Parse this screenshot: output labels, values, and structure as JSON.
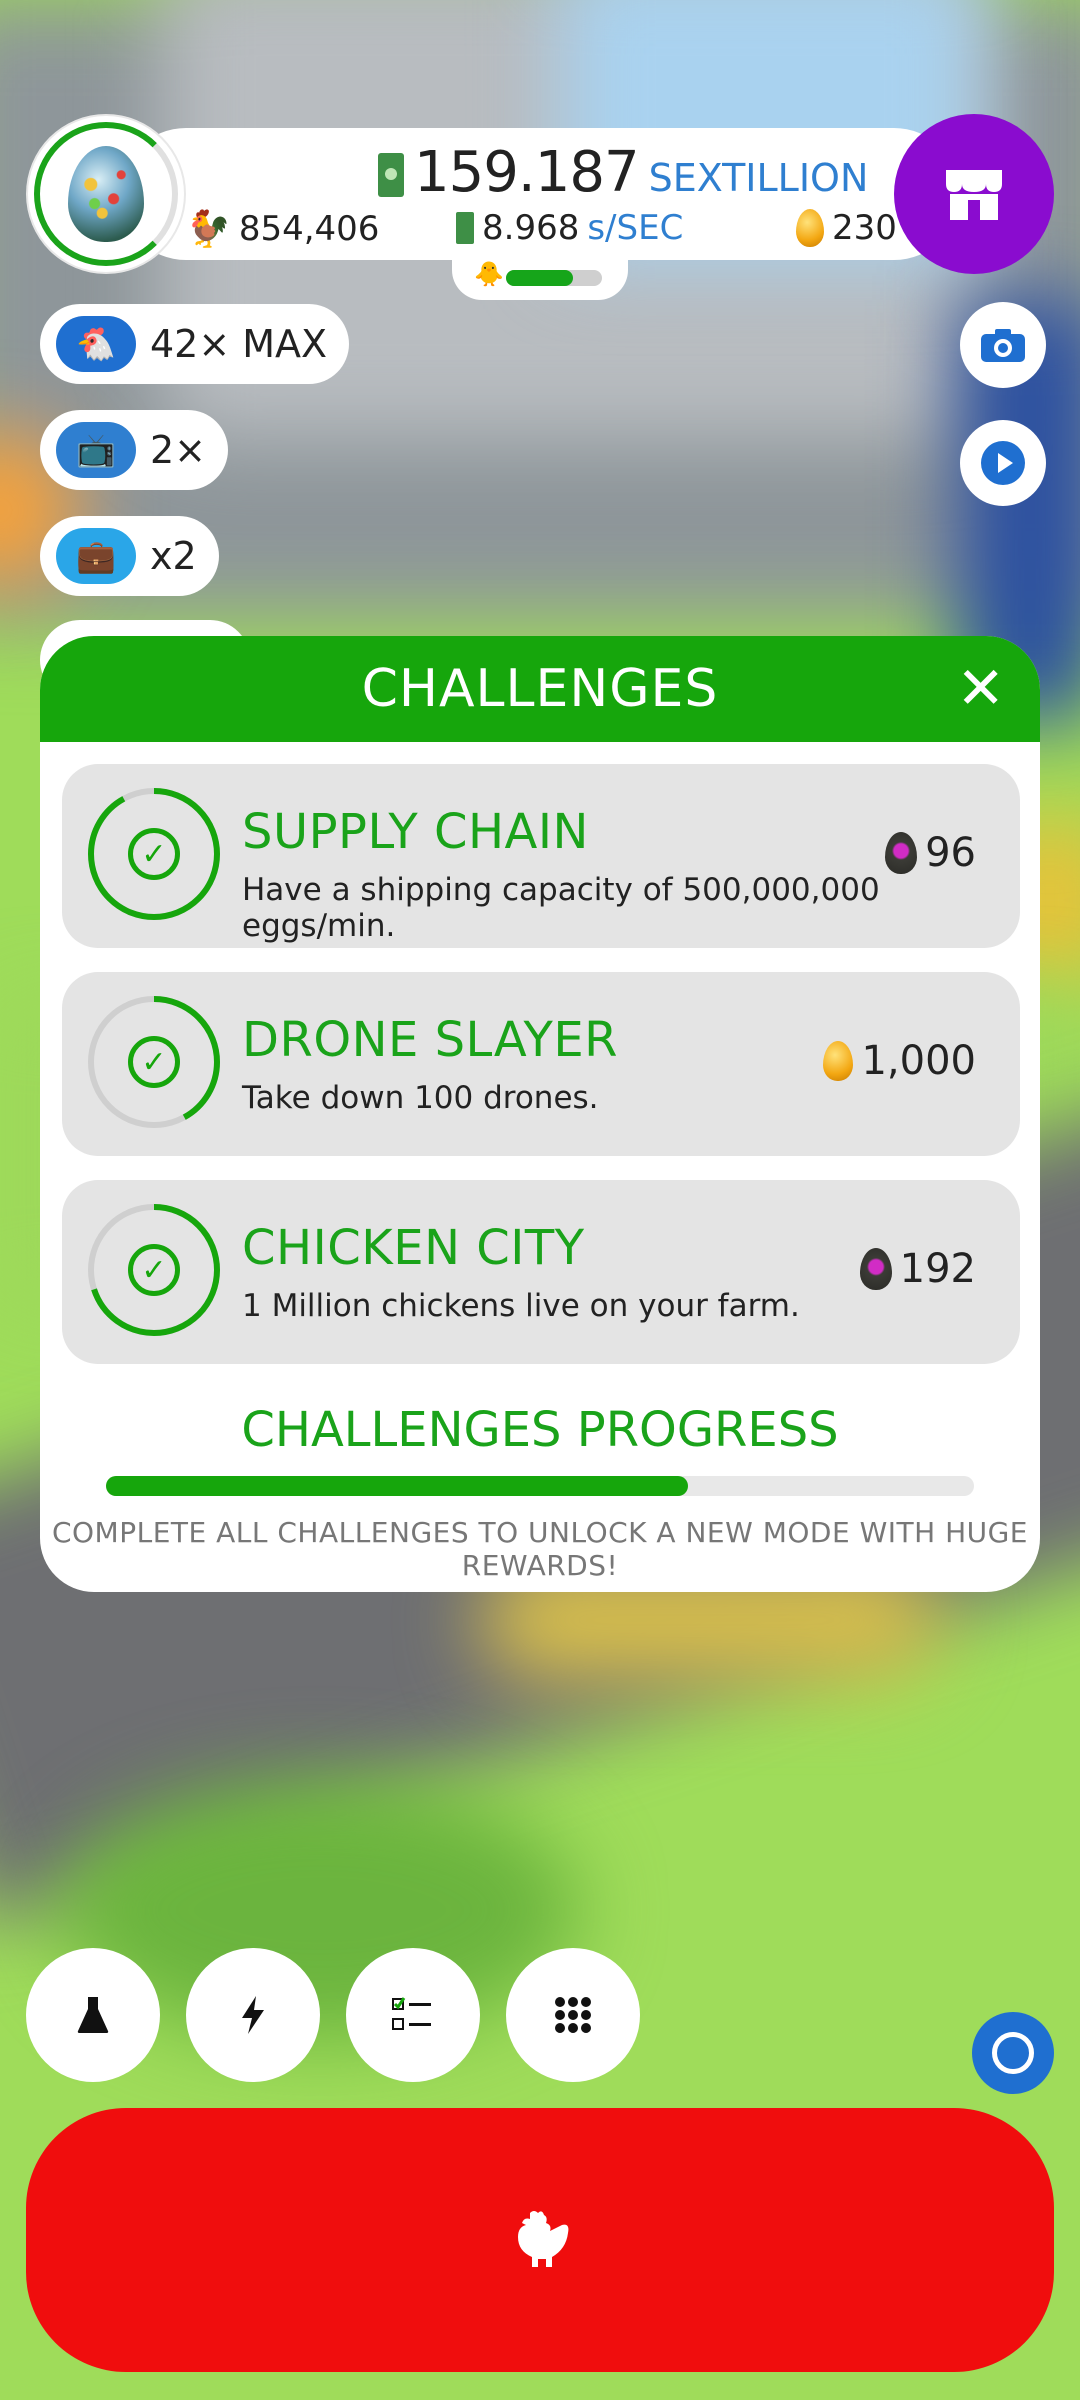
{
  "hud": {
    "money_value": "159.187",
    "money_unit": "SEXTILLION",
    "chickens": "854,406",
    "rate_value": "8.968",
    "rate_unit": "s/SEC",
    "golden_eggs": "230",
    "habitat_progress": 0.7
  },
  "boosts": [
    {
      "label": "42× MAX",
      "icon": "chicken-icon"
    },
    {
      "label": "2×",
      "icon": "tv-icon"
    },
    {
      "label": "x2",
      "icon": "boost-bag-icon"
    }
  ],
  "dialog": {
    "title": "CHALLENGES",
    "challenges": [
      {
        "title": "SUPPLY CHAIN",
        "description": "Have a shipping capacity of 500,000,000 eggs/min.",
        "reward": "96",
        "reward_type": "soul-egg",
        "progress": 0.92
      },
      {
        "title": "DRONE SLAYER",
        "description": "Take down 100 drones.",
        "reward": "1,000",
        "reward_type": "golden-egg",
        "progress": 0.42
      },
      {
        "title": "CHICKEN CITY",
        "description": "1 Million chickens live on your farm.",
        "reward": "192",
        "reward_type": "soul-egg",
        "progress": 0.7
      }
    ],
    "progress_title": "CHALLENGES PROGRESS",
    "progress_fraction": 0.67,
    "progress_note": "COMPLETE ALL CHALLENGES TO UNLOCK A NEW MODE WITH HUGE REWARDS!"
  },
  "colors": {
    "accent_green": "#16a60c",
    "shop_purple": "#8a0ccf",
    "hatch_red": "#f00d0d",
    "unit_blue": "#2f7fd0"
  }
}
